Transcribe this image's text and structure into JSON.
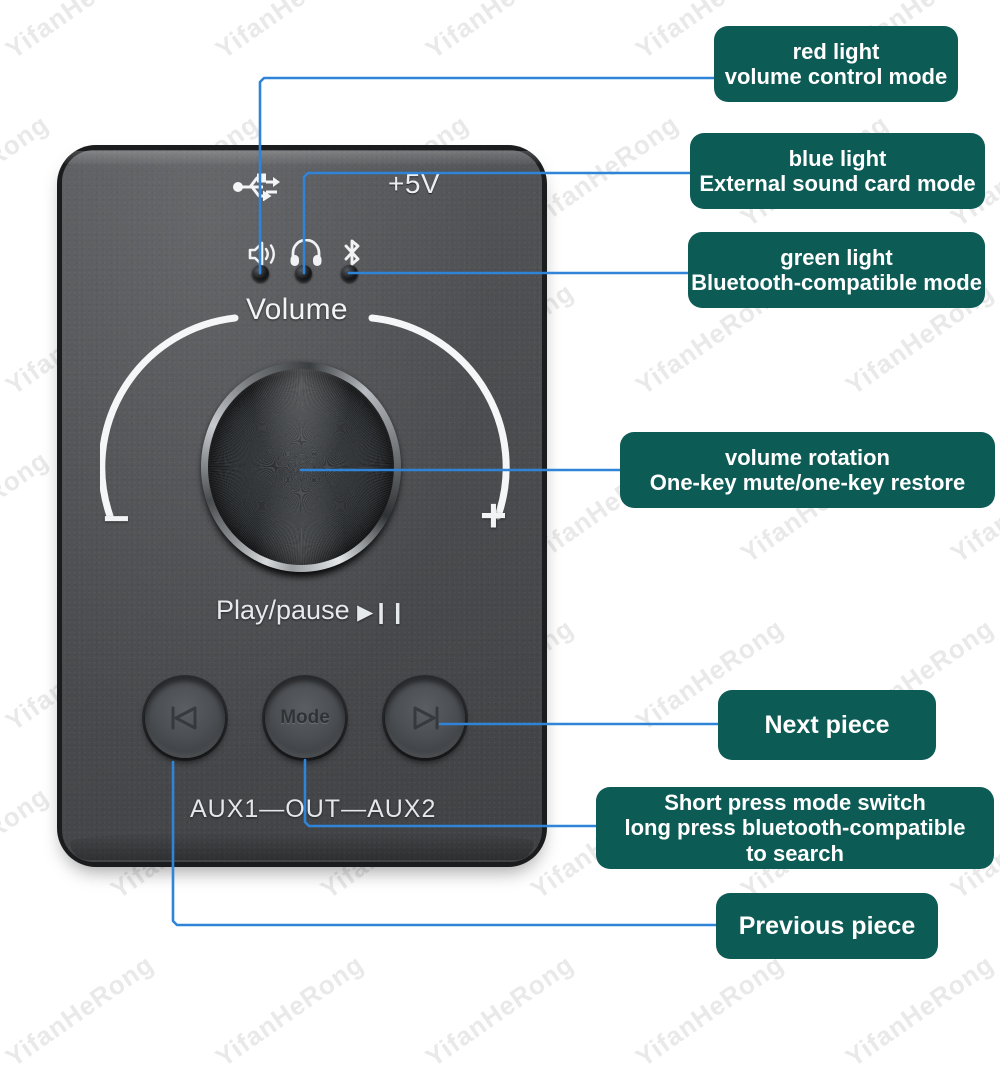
{
  "meta": {
    "watermark_text": "YifanHeRong",
    "accent_callout_color": "#0d5b55",
    "leader_line_color": "#2f84d8",
    "background_color": "#ffffff"
  },
  "device": {
    "power_label": "+5V",
    "usb_icon": "usb-icon",
    "volume_label": "Volume",
    "minus_label": "−",
    "plus_label": "+",
    "play_pause_label": "Play/pause",
    "play_pause_glyph": "▶❙❙",
    "aux_label": "AUX1—OUT—AUX2",
    "indicators": [
      {
        "icon": "speaker-icon",
        "name": "volume-control-indicator",
        "led": "red-led"
      },
      {
        "icon": "headphone-icon",
        "name": "sound-card-indicator",
        "led": "blue-led"
      },
      {
        "icon": "bluetooth-icon",
        "name": "bluetooth-indicator",
        "led": "green-led"
      }
    ],
    "buttons": [
      {
        "name": "previous-button",
        "label": "",
        "icon": "previous-track-icon"
      },
      {
        "name": "mode-button",
        "label": "Mode",
        "icon": ""
      },
      {
        "name": "next-button",
        "label": "",
        "icon": "next-track-icon"
      }
    ]
  },
  "callouts": [
    {
      "id": "red-light",
      "lines": [
        "red light",
        "volume control mode"
      ]
    },
    {
      "id": "blue-light",
      "lines": [
        "blue light",
        "External sound card mode"
      ]
    },
    {
      "id": "green-light",
      "lines": [
        "green light",
        "Bluetooth-compatible mode"
      ]
    },
    {
      "id": "volume-rotation",
      "lines": [
        "volume rotation",
        "One-key mute/one-key restore"
      ]
    },
    {
      "id": "next-piece",
      "lines": [
        "Next piece"
      ]
    },
    {
      "id": "mode-switch",
      "lines": [
        "Short press mode switch",
        "long press bluetooth-compatible",
        "to search"
      ]
    },
    {
      "id": "previous-piece",
      "lines": [
        "Previous piece"
      ]
    }
  ]
}
